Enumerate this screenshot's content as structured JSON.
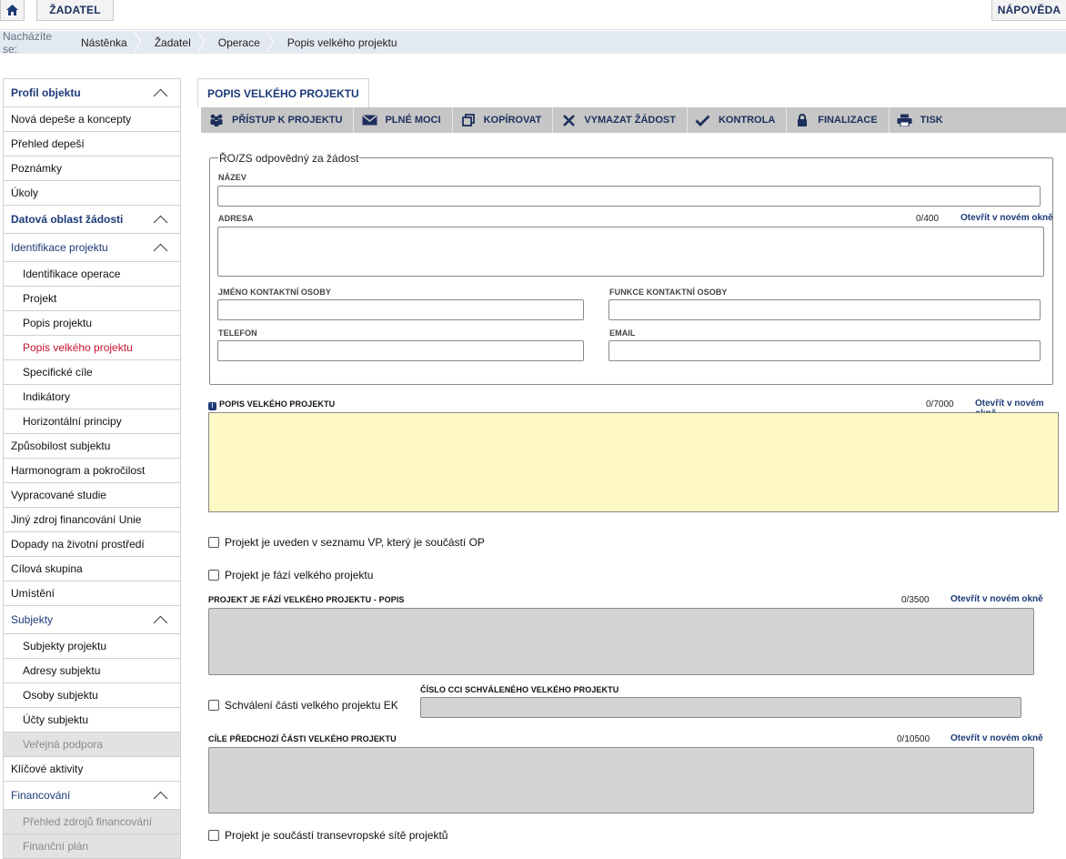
{
  "topbar": {
    "applicant_label": "ŽADATEL",
    "help_label": "NÁPOVĚDA"
  },
  "breadcrumb": {
    "lead": "Nacházíte se:",
    "items": [
      "Nástěnka",
      "Žadatel",
      "Operace",
      "Popis velkého projektu"
    ]
  },
  "sidenav": {
    "items": [
      {
        "label": "Profil objektu"
      },
      {
        "label": "Nová depeše a koncepty"
      },
      {
        "label": "Přehled depeší"
      },
      {
        "label": "Poznámky"
      },
      {
        "label": "Úkoly"
      },
      {
        "label": "Datová oblast žádosti"
      },
      {
        "label": "Identifikace projektu"
      },
      {
        "label": "Identifikace operace"
      },
      {
        "label": "Projekt"
      },
      {
        "label": "Popis projektu"
      },
      {
        "label": "Popis velkého projektu"
      },
      {
        "label": "Specifické cíle"
      },
      {
        "label": "Indikátory"
      },
      {
        "label": "Horizontální principy"
      },
      {
        "label": "Způsobilost subjektu"
      },
      {
        "label": "Harmonogram a pokročilost"
      },
      {
        "label": "Vypracované studie"
      },
      {
        "label": "Jiný zdroj financování Unie"
      },
      {
        "label": "Dopady na životní prostředí"
      },
      {
        "label": "Cílová skupina"
      },
      {
        "label": "Umístění"
      },
      {
        "label": "Subjekty"
      },
      {
        "label": "Subjekty projektu"
      },
      {
        "label": "Adresy subjektu"
      },
      {
        "label": "Osoby subjektu"
      },
      {
        "label": "Účty subjektu"
      },
      {
        "label": "Veřejná podpora"
      },
      {
        "label": "Klíčové aktivity"
      },
      {
        "label": "Financování"
      },
      {
        "label": "Přehled zdrojů financování"
      },
      {
        "label": "Finanční plán"
      }
    ]
  },
  "main": {
    "tab_title": "POPIS VELKÉHO PROJEKTU",
    "toolbar": {
      "access": "PŘÍSTUP K PROJEKTU",
      "power": "PLNÉ MOCI",
      "copy": "KOPÍROVAT",
      "delete": "VYMAZAT ŽÁDOST",
      "check": "KONTROLA",
      "finalize": "FINALIZACE",
      "print": "TISK"
    },
    "responsible": {
      "legend": "ŘO/ZS odpovědný za žádost",
      "name_label": "NÁZEV",
      "address_label": "ADRESA",
      "address_counter": "0/400",
      "contact_name_label": "JMÉNO KONTAKTNÍ OSOBY",
      "contact_role_label": "FUNKCE KONTAKTNÍ OSOBY",
      "phone_label": "TELEFON",
      "email_label": "EMAIL"
    },
    "open_new_window": "Otevřít v novém okně",
    "description": {
      "label": "POPIS VELKÉHO PROJEKTU",
      "counter": "0/7000"
    },
    "cb_list": "Projekt je uveden v seznamu VP, který je součástí OP",
    "cb_phase": "Projekt je fází velkého projektu",
    "phase_desc": {
      "label": "PROJEKT JE FÁZÍ VELKÉHO PROJEKTU - POPIS",
      "counter": "0/3500"
    },
    "cb_approval": "Schválení části velkého projektu EK",
    "cci_label": "ČÍSLO CCI SCHVÁLENÉHO VELKÉHO PROJEKTU",
    "goals": {
      "label": "CÍLE PŘEDCHOZÍ ČÁSTI VELKÉHO PROJEKTU",
      "counter": "0/10500"
    },
    "cb_network": "Projekt je součástí transevropské sítě projektů"
  }
}
